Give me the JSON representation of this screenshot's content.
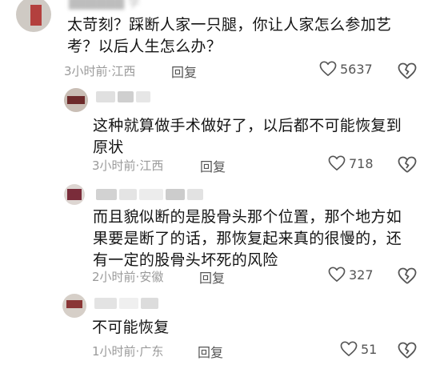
{
  "comments": [
    {
      "text": "太苛刻？踩断人家一只腿，你让人家怎么参加艺考？以后人生怎么办？",
      "time": "3小时前",
      "location": "江西",
      "reply_label": "回复",
      "likes": "5637"
    },
    {
      "text": "这种就算做手术做好了，以后都不可能恢复到原状",
      "time": "3小时前",
      "location": "江西",
      "reply_label": "回复",
      "likes": "718"
    },
    {
      "text": "而且貌似断的是股骨头那个位置，那个地方如果要是断了的话，那恢复起来真的很慢的，还有一定的股骨头坏死的风险",
      "time": "2小时前",
      "location": "安徽",
      "reply_label": "回复",
      "likes": "327"
    },
    {
      "text": "不可能恢复",
      "time": "1小时前",
      "location": "广东",
      "reply_label": "回复",
      "likes": "51"
    }
  ],
  "meta_separator": "·",
  "icons": {
    "like": "heart-outline-icon",
    "dislike": "broken-heart-icon"
  },
  "colors": {
    "text": "#141414",
    "meta": "#9a9a9a",
    "icon": "#555555"
  }
}
